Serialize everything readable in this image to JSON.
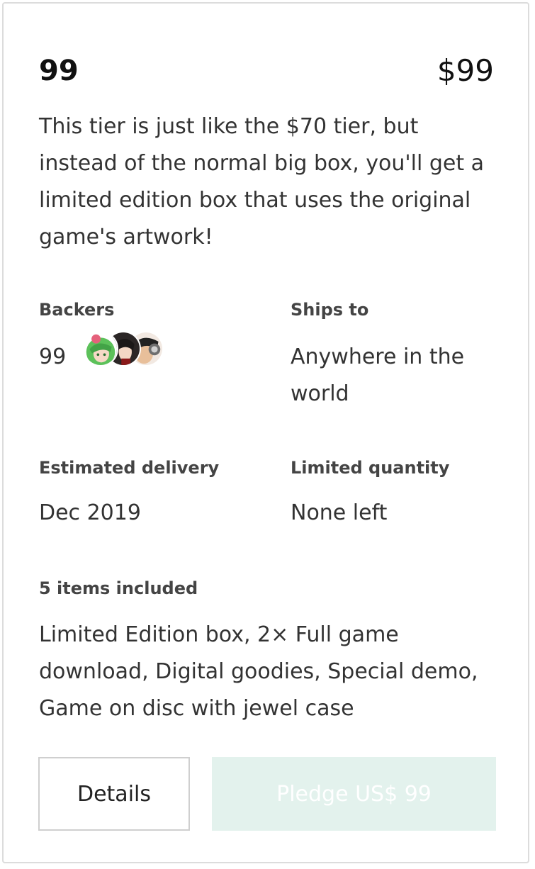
{
  "tier": {
    "name": "99",
    "price": "$99",
    "description": "This tier is just like the $70 tier, but instead of the normal big box, you'll get a limited edition box that uses the original game's artwork!"
  },
  "backers": {
    "label": "Backers",
    "count": "99",
    "avatars": [
      "green-haired-character-avatar",
      "dark-haired-character-avatar",
      "headphones-character-avatar"
    ]
  },
  "ships_to": {
    "label": "Ships to",
    "value": "Anywhere in the world"
  },
  "delivery": {
    "label": "Estimated delivery",
    "value": "Dec 2019"
  },
  "quantity": {
    "label": "Limited quantity",
    "value": "None left"
  },
  "items": {
    "label": "5 items included",
    "value": "Limited Edition box, 2× Full game download, Digital goodies, Special demo, Game on disc with jewel case"
  },
  "buttons": {
    "details": "Details",
    "pledge": "Pledge US$ 99"
  },
  "colors": {
    "pledge_disabled_bg": "#e3f2ed",
    "border": "#dcdcdc"
  }
}
